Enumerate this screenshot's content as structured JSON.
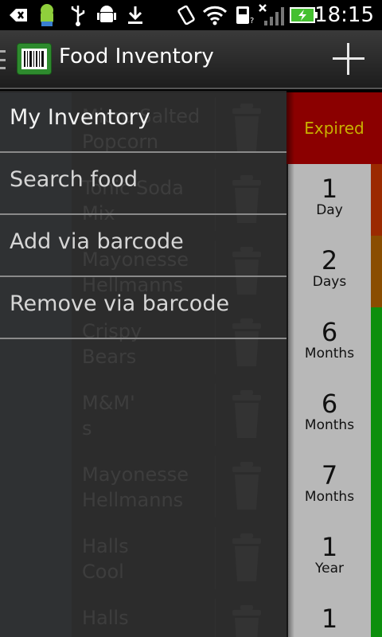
{
  "status_bar": {
    "time": "18:15",
    "icons": [
      "usb-debug-icon",
      "android-icon",
      "usb-icon",
      "android-robot-icon",
      "download-icon",
      "vibrate-icon",
      "wifi-icon",
      "sd-card-icon",
      "no-signal-icon",
      "battery-charging-icon"
    ]
  },
  "action_bar": {
    "title": "Food Inventory",
    "logo_icon": "barcode-icon",
    "add_icon": "plus-icon"
  },
  "drawer": {
    "items": [
      {
        "label": "My Inventory",
        "selected": true
      },
      {
        "label": "Search food",
        "selected": false
      },
      {
        "label": "Add via barcode",
        "selected": false
      },
      {
        "label": "Remove via barcode",
        "selected": false
      }
    ]
  },
  "inventory": [
    {
      "name_line1": "Micro Salted",
      "name_line2": "Popcorn",
      "expired_label": "Expired",
      "stripe": "#8b0000"
    },
    {
      "name_line1": "Tonic Soda",
      "name_line2": "Mix",
      "num": "1",
      "unit": "Day",
      "stripe": "#9b2a00"
    },
    {
      "name_line1": "Mayonesse",
      "name_line2": "Hellmanns",
      "num": "2",
      "unit": "Days",
      "stripe": "#8a4d00"
    },
    {
      "name_line1": "Crispy",
      "name_line2": "Bears",
      "num": "6",
      "unit": "Months",
      "stripe": "#0d8f0d"
    },
    {
      "name_line1": "M&M'",
      "name_line2": "s",
      "num": "6",
      "unit": "Months",
      "stripe": "#0d8f0d"
    },
    {
      "name_line1": "Mayonesse",
      "name_line2": "Hellmanns",
      "num": "7",
      "unit": "Months",
      "stripe": "#0d8f0d"
    },
    {
      "name_line1": "Halls",
      "name_line2": "Cool",
      "num": "1",
      "unit": "Year",
      "stripe": "#0d8f0d"
    },
    {
      "name_line1": "Halls",
      "name_line2": "",
      "num": "1",
      "unit": "",
      "stripe": "#0d8f0d"
    }
  ],
  "colors": {
    "expired_bg": "#8b0000",
    "expired_text": "#c9b200",
    "countdown_bg": "#b8b8b8",
    "ok_stripe": "#0d8f0d",
    "logo_green": "#2e8b2e"
  }
}
